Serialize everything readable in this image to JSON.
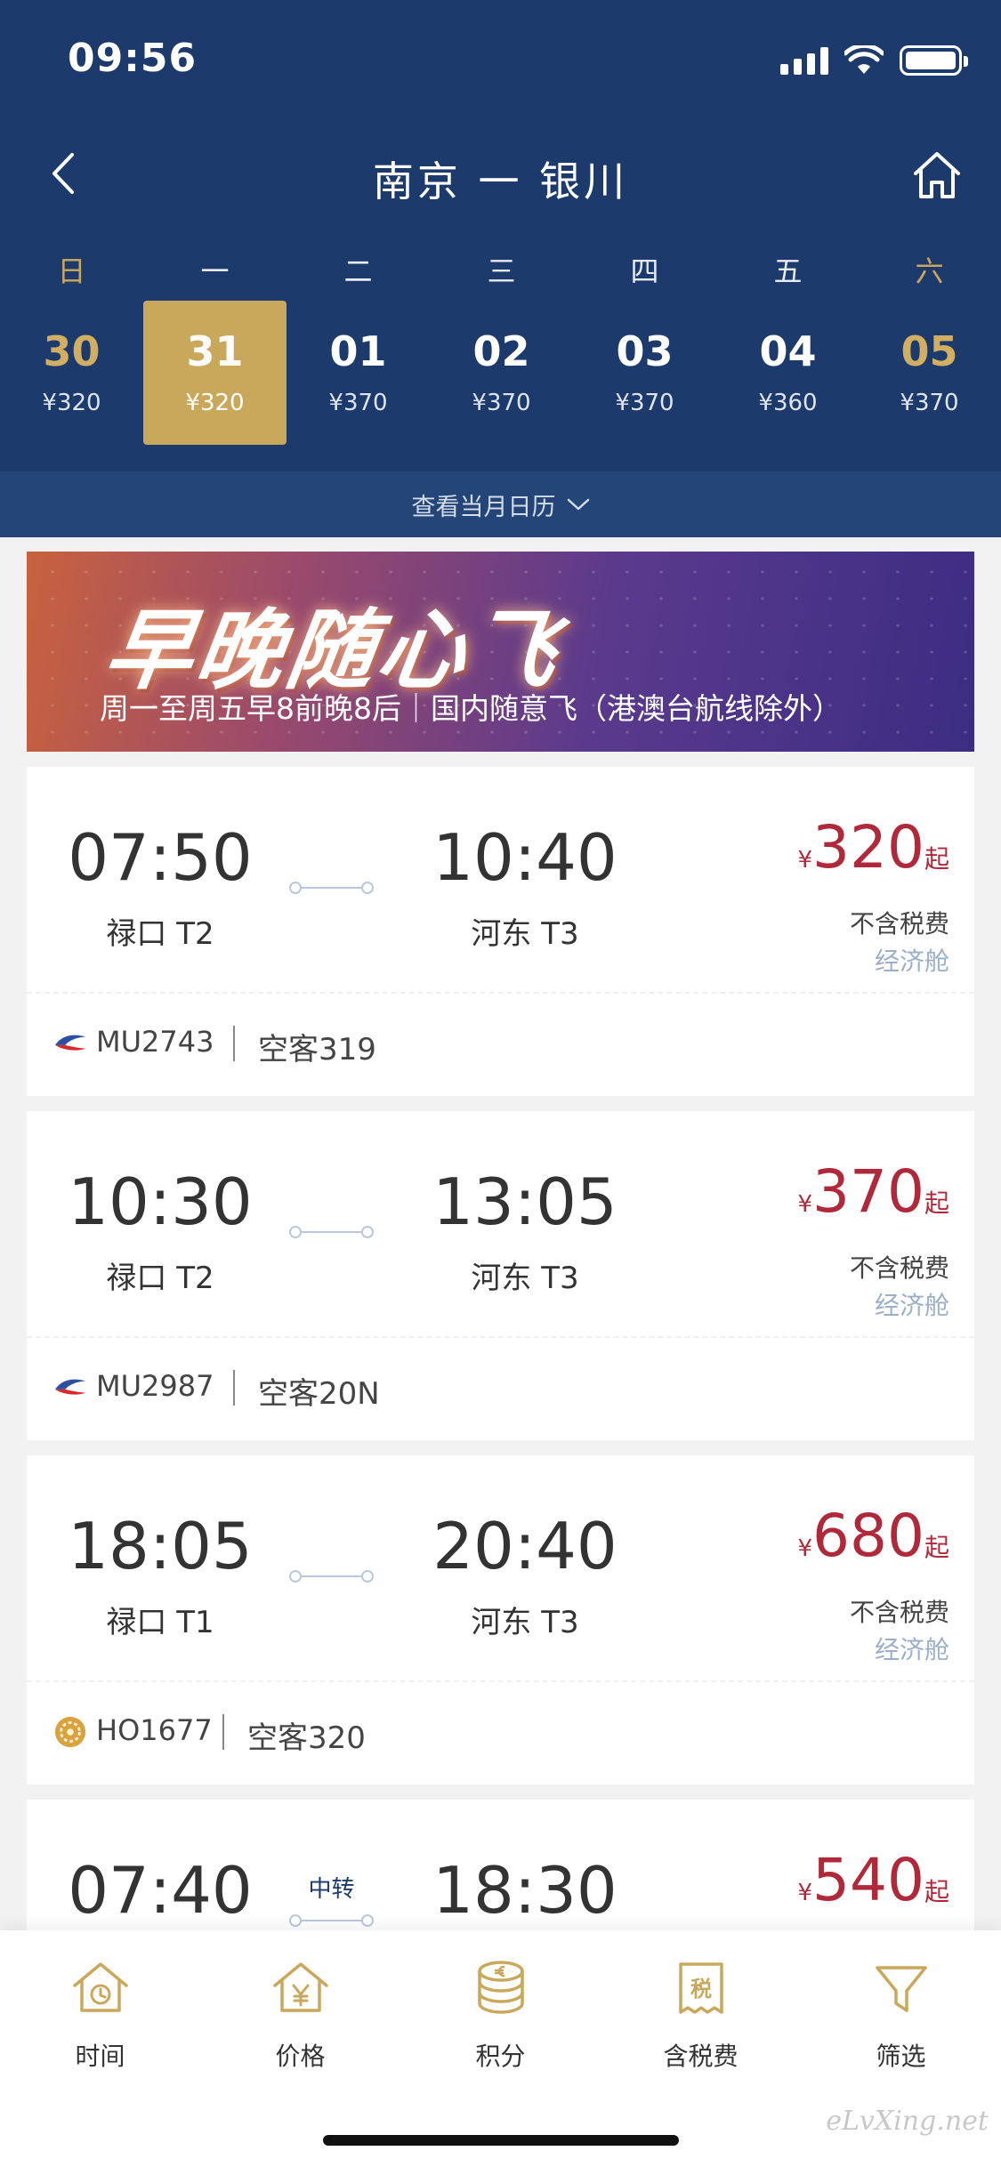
{
  "status_bar": {
    "time": "09:56"
  },
  "header": {
    "route_title": "南京 一 银川"
  },
  "weekdays": [
    "日",
    "一",
    "二",
    "三",
    "四",
    "五",
    "六"
  ],
  "dates": [
    {
      "day": "30",
      "price": "¥320",
      "weekend": true,
      "selected": false
    },
    {
      "day": "31",
      "price": "¥320",
      "weekend": false,
      "selected": true
    },
    {
      "day": "01",
      "price": "¥370",
      "weekend": false,
      "selected": false
    },
    {
      "day": "02",
      "price": "¥370",
      "weekend": false,
      "selected": false
    },
    {
      "day": "03",
      "price": "¥370",
      "weekend": false,
      "selected": false
    },
    {
      "day": "04",
      "price": "¥360",
      "weekend": false,
      "selected": false
    },
    {
      "day": "05",
      "price": "¥370",
      "weekend": true,
      "selected": false
    }
  ],
  "month_calendar_label": "查看当月日历",
  "banner": {
    "title": "早晚随心飞",
    "subtitle": "周一至周五早8前晚8后｜国内随意飞（港澳台航线除外）"
  },
  "flights": [
    {
      "dep_time": "07:50",
      "dep_airport": "禄口 T2",
      "arr_time": "10:40",
      "arr_airport": "河东 T3",
      "currency": "¥",
      "price": "320",
      "price_suffix": "起",
      "tax_note": "不含税费",
      "cabin": "经济舱",
      "flight_no": "MU2743",
      "aircraft": "空客319",
      "transfer": "",
      "airline_icon": "china-eastern-logo"
    },
    {
      "dep_time": "10:30",
      "dep_airport": "禄口 T2",
      "arr_time": "13:05",
      "arr_airport": "河东 T3",
      "currency": "¥",
      "price": "370",
      "price_suffix": "起",
      "tax_note": "不含税费",
      "cabin": "经济舱",
      "flight_no": "MU2987",
      "aircraft": "空客20N",
      "transfer": "",
      "airline_icon": "china-eastern-logo"
    },
    {
      "dep_time": "18:05",
      "dep_airport": "禄口 T1",
      "arr_time": "20:40",
      "arr_airport": "河东 T3",
      "currency": "¥",
      "price": "680",
      "price_suffix": "起",
      "tax_note": "不含税费",
      "cabin": "经济舱",
      "flight_no": "HO1677",
      "aircraft": "空客320",
      "transfer": "",
      "airline_icon": "juneyao-logo"
    },
    {
      "dep_time": "07:40",
      "dep_airport": "",
      "arr_time": "18:30",
      "arr_airport": "",
      "currency": "¥",
      "price": "540",
      "price_suffix": "起",
      "tax_note": "",
      "cabin": "",
      "flight_no": "",
      "aircraft": "",
      "transfer": "中转",
      "airline_icon": ""
    }
  ],
  "tabbar": [
    {
      "label": "时间",
      "icon": "clock-house-icon"
    },
    {
      "label": "价格",
      "icon": "yuan-house-icon"
    },
    {
      "label": "积分",
      "icon": "coins-icon"
    },
    {
      "label": "含税费",
      "icon": "tax-receipt-icon"
    },
    {
      "label": "筛选",
      "icon": "filter-funnel-icon"
    }
  ],
  "watermark": "eLvXing.net",
  "colors": {
    "header_bg": "#1c3a6b",
    "gold": "#c9a85c",
    "price_red": "#b0293a",
    "cabin_blue": "#9bb0c8"
  }
}
